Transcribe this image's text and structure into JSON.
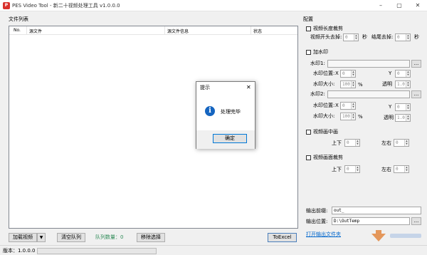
{
  "window": {
    "title": "PES Video Tool - 新二十视频处理工具 v1.0.0.0",
    "icon_text": "P"
  },
  "file_list": {
    "section_label": "文件列表",
    "columns": [
      "No.",
      "源文件",
      "源文件信息",
      "状态"
    ]
  },
  "config": {
    "section_label": "配置",
    "trim": {
      "label": "视频长度裁剪",
      "start_label": "视频开头去掉:",
      "start_value": "0",
      "sec1": "秒",
      "end_label": "结尾去掉:",
      "end_value": "0",
      "sec2": "秒"
    },
    "watermark": {
      "label": "加水印",
      "wm1_label": "水印1:",
      "pos1_label": "水印位置:",
      "x_label": "X",
      "x1_value": "0",
      "y_label": "Y",
      "y1_value": "0",
      "size1_label": "水印大小:",
      "size1_value": "100",
      "pct": "%",
      "alpha1_label": "透明",
      "alpha1_value": "1.0",
      "wm2_label": "水印2:",
      "pos2_label": "水印位置:",
      "x2_value": "0",
      "y2_value": "0",
      "size2_label": "水印大小:",
      "size2_value": "100",
      "alpha2_label": "透明",
      "alpha2_value": "1.0",
      "browse": "..."
    },
    "pip": {
      "label": "视频画中画",
      "ud_label": "上下",
      "ud_value": "0",
      "lr_label": "左右",
      "lr_value": "0"
    },
    "crop": {
      "label": "视频画面裁剪",
      "ud_label": "上下",
      "ud_value": "0",
      "lr_label": "左右",
      "lr_value": "0"
    },
    "output": {
      "prefix_label": "输出前缀:",
      "prefix_value": "out_",
      "dir_label": "输出位置:",
      "dir_value": "D:\\OutTemp",
      "browse": "...",
      "open_link": "打开输出文件夹"
    }
  },
  "bottom_bar": {
    "add_video": "加载视频",
    "dropdown_arrow": "▼",
    "clear_queue": "清空队列",
    "queue_count_label": "队列数量：0",
    "remove_selected": "移除选择",
    "to_excel": "ToExcel"
  },
  "status": {
    "version": "版本：1.0.0.0"
  },
  "dialog": {
    "title": "提示",
    "message": "处理完毕",
    "ok": "确定",
    "close": "✕"
  }
}
